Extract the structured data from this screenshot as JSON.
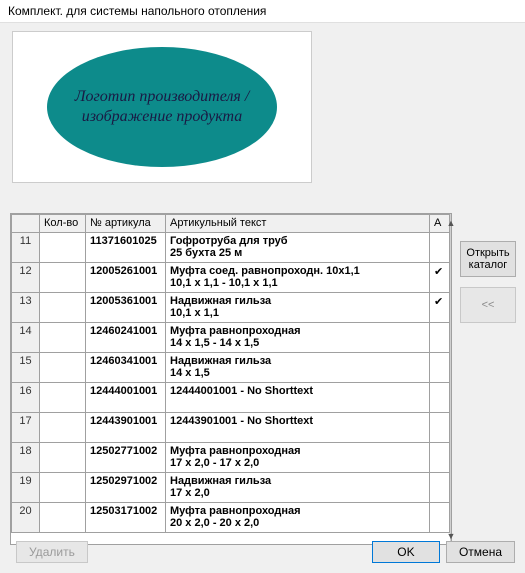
{
  "window": {
    "title": "Комплект. для системы напольного отопления"
  },
  "logo": {
    "text": "Логотип производителя / изображение продукта"
  },
  "columns": {
    "rownum": "",
    "qty": "Кол-во",
    "article": "№ артикула",
    "text": "Артикульный текст",
    "a": "А"
  },
  "rows": [
    {
      "n": "11",
      "qty": "",
      "article": "11371601025",
      "line1": "Гофротруба для труб",
      "line2": "25 бухта 25 м",
      "a": ""
    },
    {
      "n": "12",
      "qty": "",
      "article": "12005261001",
      "line1": "Муфта  соед. равнопроходн. 10x1,1",
      "line2": "10,1 x 1,1 - 10,1 x 1,1",
      "a": "✔"
    },
    {
      "n": "13",
      "qty": "",
      "article": "12005361001",
      "line1": "Надвижная гильза",
      "line2": "10,1 x 1,1",
      "a": "✔"
    },
    {
      "n": "14",
      "qty": "",
      "article": "12460241001",
      "line1": "Муфта равнопроходная",
      "line2": "14 x 1,5 - 14 x 1,5",
      "a": ""
    },
    {
      "n": "15",
      "qty": "",
      "article": "12460341001",
      "line1": "Надвижная гильза",
      "line2": "14 x 1,5",
      "a": ""
    },
    {
      "n": "16",
      "qty": "",
      "article": "12444001001",
      "line1": "12444001001 - No Shorttext",
      "line2": "",
      "a": ""
    },
    {
      "n": "17",
      "qty": "",
      "article": "12443901001",
      "line1": "12443901001 - No Shorttext",
      "line2": "",
      "a": ""
    },
    {
      "n": "18",
      "qty": "",
      "article": "12502771002",
      "line1": "Муфта равнопроходная",
      "line2": "17 x 2,0 - 17 x 2,0",
      "a": ""
    },
    {
      "n": "19",
      "qty": "",
      "article": "12502971002",
      "line1": "Надвижная гильза",
      "line2": "17 x 2,0",
      "a": ""
    },
    {
      "n": "20",
      "qty": "",
      "article": "12503171002",
      "line1": "Муфта равнопроходная",
      "line2": "20 x 2,0 - 20 x 2,0",
      "a": ""
    }
  ],
  "buttons": {
    "open_catalog": "Открыть каталог",
    "back": "<<",
    "delete": "Удалить",
    "ok": "OK",
    "cancel": "Отмена"
  }
}
